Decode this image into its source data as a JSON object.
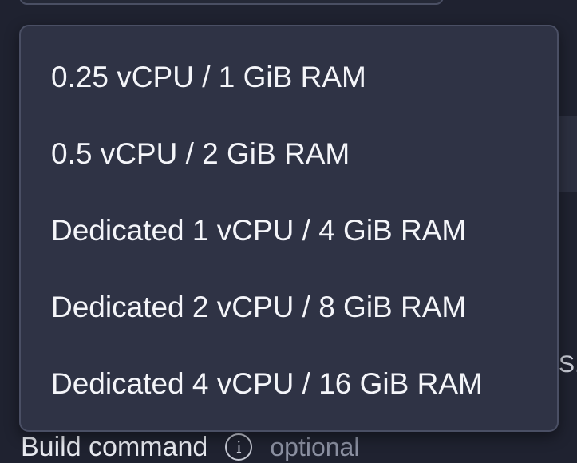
{
  "background": {
    "right_edge_text": "S.",
    "build_command_label": "Build command",
    "info_icon": "info-icon",
    "info_glyph": "i",
    "optional_text": "optional"
  },
  "dropdown": {
    "options": [
      {
        "label": "0.25 vCPU / 1 GiB RAM"
      },
      {
        "label": "0.5 vCPU / 2 GiB RAM"
      },
      {
        "label": "Dedicated 1 vCPU / 4 GiB RAM"
      },
      {
        "label": "Dedicated 2 vCPU / 8 GiB RAM"
      },
      {
        "label": "Dedicated 4 vCPU / 16 GiB RAM"
      }
    ]
  },
  "colors": {
    "page_bg": "#1f2230",
    "menu_bg": "#2f3345",
    "menu_border": "#4a4f64",
    "text": "#f4f5f9"
  }
}
